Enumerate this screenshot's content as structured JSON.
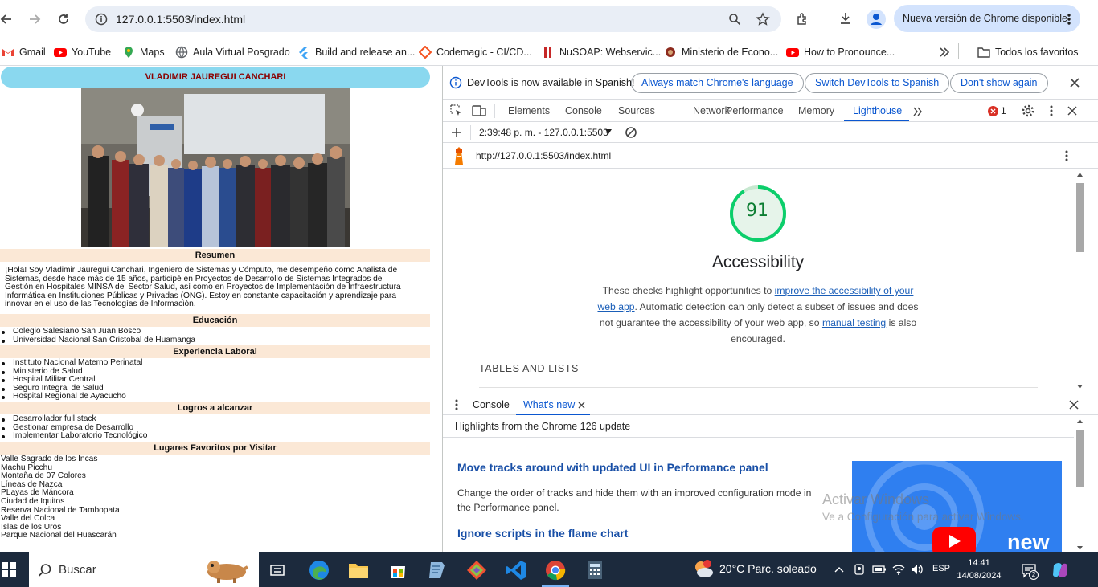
{
  "browser": {
    "url": "127.0.0.1:5503/index.html",
    "update_label": "Nueva versión de Chrome disponible",
    "bookmarks": [
      {
        "label": "Gmail",
        "icon": "gmail-icon",
        "color": "#ea4335"
      },
      {
        "label": "YouTube",
        "icon": "youtube-icon",
        "color": "#ff0000"
      },
      {
        "label": "Maps",
        "icon": "maps-icon",
        "color": "#34a853"
      },
      {
        "label": "Aula Virtual Posgrado",
        "icon": "globe-icon",
        "color": "#5f6368"
      },
      {
        "label": "Build and release an...",
        "icon": "flutter-icon",
        "color": "#42a5f5"
      },
      {
        "label": "Codemagic - CI/CD...",
        "icon": "codemagic-icon",
        "color": "#f4511e"
      },
      {
        "label": "NuSOAP: Webservic...",
        "icon": "nusoap-icon",
        "color": "#c62828"
      },
      {
        "label": "Ministerio de Econo...",
        "icon": "crest-icon",
        "color": "#8d2b1e"
      },
      {
        "label": "How to Pronounce...",
        "icon": "youtube-icon",
        "color": "#ff0000"
      }
    ],
    "all_bookmarks": "Todos los favoritos"
  },
  "page": {
    "name": "VLADIMIR JAUREGUI CANCHARI",
    "resumen_title": "Resumen",
    "resumen_lines": [
      "¡Hola! Soy Vladimir Jáuregui Canchari, Ingeniero de Sistemas y Cómputo, me desempeño como Analista de",
      "Sistemas, desde hace más de 15 años, participé en Proyectos de Desarrollo de Sistemas Integrados de",
      "Gestión en Hospitales MINSA del Sector Salud, así como en Proyectos de Implementación de Infraestructura",
      "Informática en Instituciones Públicas y Privadas (ONG). Estoy en constante capacitación y aprendizaje para",
      "innovar en el uso de las Tecnologías de Información."
    ],
    "educacion_title": "Educación",
    "educacion": [
      "Colegio Salesiano San Juan Bosco",
      "Universidad Nacional San Cristobal de Huamanga"
    ],
    "experiencia_title": "Experiencia Laboral",
    "experiencia": [
      "Instituto Nacional Materno Perinatal",
      "Ministerio de Salud",
      "Hospital Militar Central",
      "Seguro Integral de Salud",
      "Hospital Regional de Ayacucho"
    ],
    "logros_title": "Logros a alcanzar",
    "logros": [
      "Desarrollador full stack",
      "Gestionar empresa de Desarrollo",
      "Implementar Laboratorio Tecnológico"
    ],
    "lugares_title": "Lugares Favoritos por Visitar",
    "lugares": [
      "Valle Sagrado de los Incas",
      "Machu Picchu",
      "Montaña de 07 Colores",
      "Líneas de Nazca",
      "PLayas de Máncora",
      "Ciudad de Iquitos",
      "Reserva Nacional de Tambopata",
      "Valle del Colca",
      "Islas de los Uros",
      "Parque Nacional del Huascarán"
    ]
  },
  "devtools": {
    "infobar_text": "DevTools is now available in Spanish!",
    "btn_match": "Always match Chrome's language",
    "btn_switch": "Switch DevTools to Spanish",
    "btn_dont": "Don't show again",
    "tabs": [
      "Elements",
      "Console",
      "Sources",
      "Network",
      "Performance",
      "Memory",
      "Lighthouse"
    ],
    "error_count": "1",
    "report_selector": "2:39:48 p. m. - 127.0.0.1:5503",
    "report_url": "http://127.0.0.1:5503/index.html",
    "score": 91,
    "score_color": "#0c7d32",
    "category": "Accessibility",
    "desc_1": "These checks highlight opportunities to ",
    "desc_link1": "improve the accessibility of your web app",
    "desc_2": ". Automatic detection can only detect a subset of issues and does not guarantee the accessibility of your web app, so ",
    "desc_link2": "manual testing",
    "desc_3": " is also encouraged.",
    "section": "TABLES AND LISTS",
    "drawer_tabs": [
      "Console",
      "What's new"
    ],
    "whats_new_sub": "Highlights from the Chrome 126 update",
    "wn_h1": "Move tracks around with updated UI in Performance panel",
    "wn_p1": "Change the order of tracks and hide them with an improved configuration mode in the Performance panel.",
    "wn_h2": "Ignore scripts in the flame chart",
    "video_word": "new",
    "activate_1": "Activar Windows",
    "activate_2": "Ve a Configuración para activar Windows."
  },
  "taskbar": {
    "search": "Buscar",
    "weather": "20°C  Parc. soleado",
    "lang": "ESP",
    "time": "14:41",
    "date": "14/08/2024",
    "notif_count": "2"
  }
}
